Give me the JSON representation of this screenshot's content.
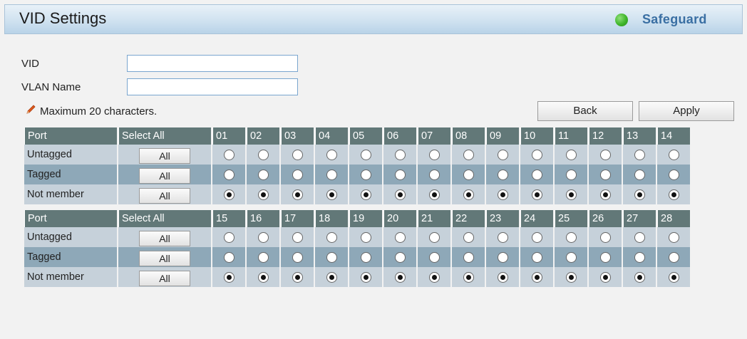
{
  "header": {
    "title": "VID Settings",
    "safeguard_label": "Safeguard"
  },
  "form": {
    "vid_label": "VID",
    "vid_value": "",
    "vlan_name_label": "VLAN Name",
    "vlan_name_value": "",
    "note": "Maximum 20 characters."
  },
  "buttons": {
    "back": "Back",
    "apply": "Apply"
  },
  "port_table": {
    "port_header": "Port",
    "select_all_header": "Select All",
    "row_labels": [
      "Untagged",
      "Tagged",
      "Not member"
    ],
    "all_button_label": "All",
    "selected_membership": "Not member",
    "groups": [
      {
        "ports": [
          "01",
          "02",
          "03",
          "04",
          "05",
          "06",
          "07",
          "08",
          "09",
          "10",
          "11",
          "12",
          "13",
          "14"
        ]
      },
      {
        "ports": [
          "15",
          "16",
          "17",
          "18",
          "19",
          "20",
          "21",
          "22",
          "23",
          "24",
          "25",
          "26",
          "27",
          "28"
        ]
      }
    ]
  },
  "colors": {
    "header_bg": "#627878",
    "row_light": "#c6d1da",
    "row_dark": "#8ea8b8",
    "input_border": "#7aa6cf",
    "safeguard_text": "#3a6fa3",
    "safeguard_icon": "#3fb52a"
  },
  "icons": {
    "safeguard": "green-status-dot",
    "note": "pencil-icon"
  }
}
